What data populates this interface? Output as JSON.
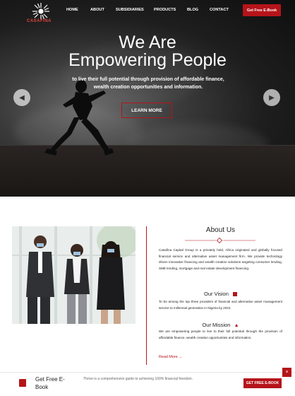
{
  "brand": {
    "name": "CASAFINA",
    "accent": "#b5141a"
  },
  "nav": {
    "items": [
      {
        "label": "HOME"
      },
      {
        "label": "ABOUT"
      },
      {
        "label": "SUBSIDIARIES"
      },
      {
        "label": "PRODUCTS"
      },
      {
        "label": "BLOG"
      },
      {
        "label": "CONTACT"
      }
    ],
    "cta": "Get Free E-Book"
  },
  "hero": {
    "title_line1": "We Are",
    "title_line2": "Empowering People",
    "subtitle_line1": "to live their full potential through provision of affordable finance,",
    "subtitle_line2": "wealth creation opportunities and information.",
    "button": "LEARN MORE",
    "prev_icon": "chevron-left-icon",
    "next_icon": "chevron-right-icon"
  },
  "about": {
    "title": "About Us",
    "body": "Casafina Capital Group is a privately held, Africa originated and globally focused financial service and alternative asset management firm. We provide technology driven innovative financing and wealth creation solutions targeting consumer lending, SME lending, mortgage and real estate development financing.",
    "vision_title": "Our Vision",
    "vision_body": "To be among the top three providers of financial and alternative asset management service to millennial generation in Nigeria by 2022.",
    "mission_title": "Our Mission",
    "mission_body": "We are empowering people to live to their full potential through the provision of affordable finance, wealth creation opportunities and information.",
    "read_more": "Read More"
  },
  "ebook_bar": {
    "title": "Get Free E-Book",
    "description": "Thrive is a comprehensive guide to achieving 100% financial freedom.",
    "button": "GET FREE E-BOOK",
    "close": "×"
  }
}
